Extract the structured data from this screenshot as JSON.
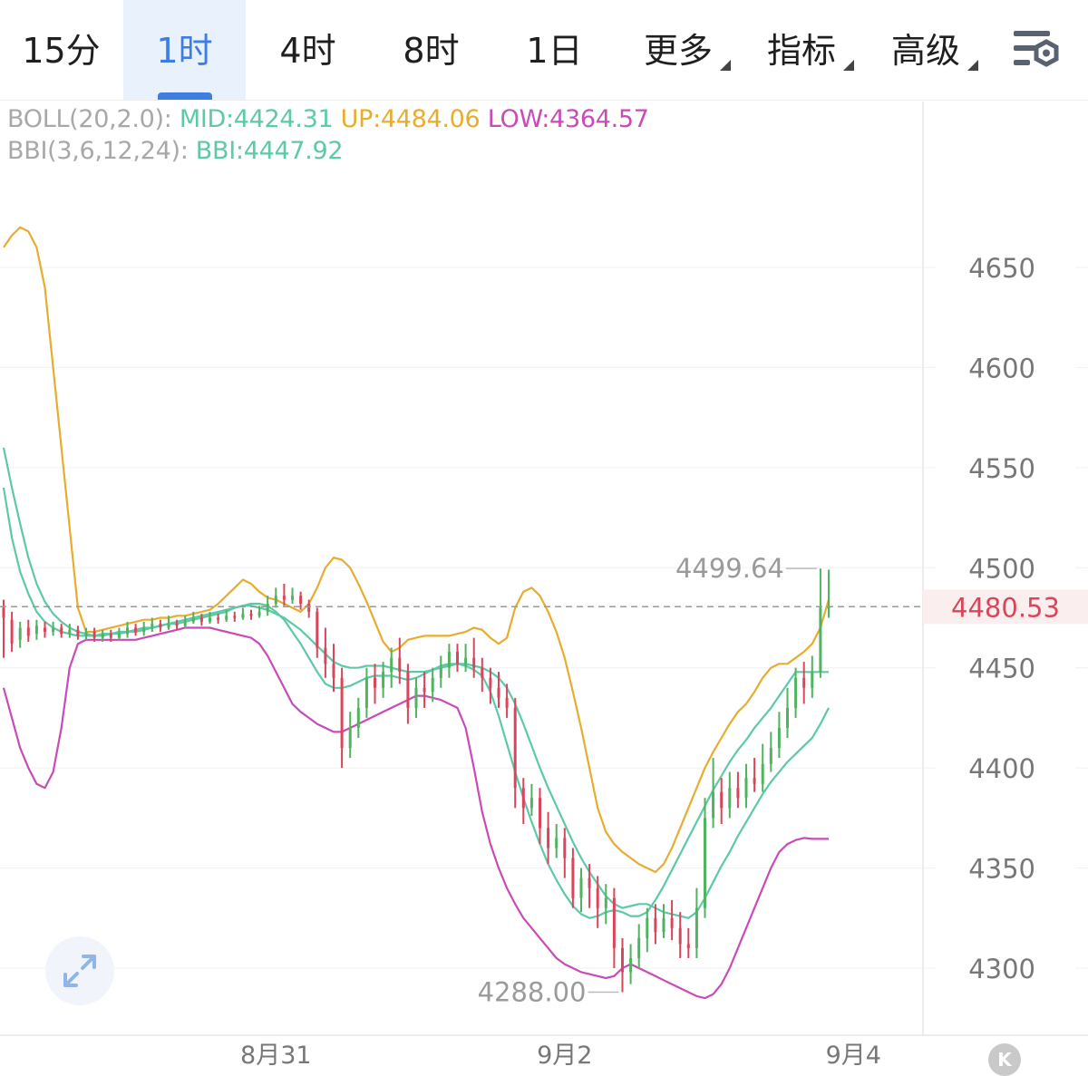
{
  "timeframe_tabs": [
    {
      "label": "15分",
      "active": false
    },
    {
      "label": "1时",
      "active": true
    },
    {
      "label": "4时",
      "active": false
    },
    {
      "label": "8时",
      "active": false
    },
    {
      "label": "1日",
      "active": false
    }
  ],
  "dropdowns": [
    {
      "label": "更多"
    },
    {
      "label": "指标"
    },
    {
      "label": "高级"
    }
  ],
  "icons": {
    "settings": "chart-settings-icon",
    "expand": "expand-arrows-icon",
    "kline": "kline-toggle-icon"
  },
  "kline_button_label": "K",
  "indicators": {
    "boll": {
      "name": "BOLL(20,2.0):",
      "mid": "MID:4424.31",
      "up": "UP:4484.06",
      "low": "LOW:4364.57"
    },
    "bbi": {
      "name": "BBI(3,6,12,24):",
      "bbi": "BBI:4447.92"
    }
  },
  "colors": {
    "accent": "#3d7ee0",
    "mid": "#5cc9a7",
    "up": "#e6ad2e",
    "low": "#c94bb8",
    "bbi": "#5cc9a7",
    "candle_up": "#4fb35f",
    "candle_down": "#d9465b",
    "current_price": "#d9465b"
  },
  "chart_data": {
    "type": "candlestick",
    "ylim": [
      4275,
      4700
    ],
    "y_ticks": [
      "4650",
      "4600",
      "4550",
      "4500",
      "4450",
      "4400",
      "4350",
      "4300"
    ],
    "x_ticks": [
      "8月31",
      "9月2",
      "9月4"
    ],
    "current_price": {
      "label": "4480.53",
      "value": 4480.53
    },
    "annotations": [
      {
        "label": "4499.64",
        "value": 4499.64,
        "bar": 99
      },
      {
        "label": "4288.00",
        "value": 4288.0,
        "bar": 75
      }
    ],
    "x_tick_bars": [
      33,
      68,
      103
    ],
    "candles": [
      [
        4480,
        4475,
        4484,
        4455
      ],
      [
        4474,
        4462,
        4478,
        4458
      ],
      [
        4464,
        4470,
        4473,
        4460
      ],
      [
        4470,
        4466,
        4474,
        4463
      ],
      [
        4467,
        4471,
        4474,
        4464
      ],
      [
        4470,
        4468,
        4473,
        4465
      ],
      [
        4468,
        4470,
        4473,
        4466
      ],
      [
        4470,
        4467,
        4472,
        4465
      ],
      [
        4467,
        4469,
        4472,
        4465
      ],
      [
        4469,
        4466,
        4471,
        4464
      ],
      [
        4466,
        4468,
        4470,
        4464
      ],
      [
        4468,
        4465,
        4470,
        4463
      ],
      [
        4465,
        4467,
        4469,
        4463
      ],
      [
        4467,
        4465,
        4469,
        4463
      ],
      [
        4465,
        4467,
        4470,
        4464
      ],
      [
        4467,
        4470,
        4473,
        4465
      ],
      [
        4470,
        4468,
        4472,
        4466
      ],
      [
        4468,
        4470,
        4473,
        4466
      ],
      [
        4470,
        4472,
        4475,
        4468
      ],
      [
        4472,
        4470,
        4474,
        4468
      ],
      [
        4470,
        4472,
        4476,
        4469
      ],
      [
        4472,
        4471,
        4474,
        4469
      ],
      [
        4471,
        4473,
        4476,
        4470
      ],
      [
        4473,
        4475,
        4478,
        4472
      ],
      [
        4475,
        4473,
        4477,
        4471
      ],
      [
        4473,
        4475,
        4478,
        4472
      ],
      [
        4475,
        4474,
        4477,
        4472
      ],
      [
        4474,
        4476,
        4479,
        4473
      ],
      [
        4476,
        4475,
        4478,
        4473
      ],
      [
        4475,
        4477,
        4480,
        4474
      ],
      [
        4477,
        4476,
        4479,
        4474
      ],
      [
        4476,
        4478,
        4481,
        4475
      ],
      [
        4478,
        4482,
        4486,
        4476
      ],
      [
        4482,
        4486,
        4490,
        4480
      ],
      [
        4486,
        4484,
        4492,
        4481
      ],
      [
        4484,
        4486,
        4490,
        4482
      ],
      [
        4486,
        4482,
        4488,
        4479
      ],
      [
        4482,
        4478,
        4484,
        4475
      ],
      [
        4478,
        4460,
        4480,
        4455
      ],
      [
        4460,
        4452,
        4470,
        4445
      ],
      [
        4452,
        4445,
        4462,
        4438
      ],
      [
        4445,
        4410,
        4450,
        4400
      ],
      [
        4410,
        4420,
        4428,
        4405
      ],
      [
        4420,
        4430,
        4435,
        4415
      ],
      [
        4430,
        4445,
        4450,
        4425
      ],
      [
        4445,
        4440,
        4452,
        4432
      ],
      [
        4440,
        4448,
        4453,
        4435
      ],
      [
        4448,
        4455,
        4460,
        4440
      ],
      [
        4455,
        4448,
        4465,
        4442
      ],
      [
        4448,
        4430,
        4452,
        4422
      ],
      [
        4430,
        4440,
        4445,
        4425
      ],
      [
        4440,
        4438,
        4448,
        4430
      ],
      [
        4438,
        4445,
        4450,
        4433
      ],
      [
        4445,
        4450,
        4456,
        4440
      ],
      [
        4450,
        4458,
        4462,
        4445
      ],
      [
        4458,
        4452,
        4462,
        4448
      ],
      [
        4452,
        4455,
        4462,
        4448
      ],
      [
        4455,
        4450,
        4465,
        4445
      ],
      [
        4450,
        4445,
        4455,
        4438
      ],
      [
        4445,
        4440,
        4450,
        4432
      ],
      [
        4440,
        4435,
        4448,
        4430
      ],
      [
        4435,
        4430,
        4442,
        4425
      ],
      [
        4430,
        4390,
        4435,
        4380
      ],
      [
        4390,
        4380,
        4395,
        4372
      ],
      [
        4380,
        4385,
        4392,
        4376
      ],
      [
        4385,
        4370,
        4390,
        4362
      ],
      [
        4370,
        4360,
        4378,
        4352
      ],
      [
        4360,
        4365,
        4372,
        4355
      ],
      [
        4365,
        4355,
        4370,
        4345
      ],
      [
        4355,
        4335,
        4360,
        4330
      ],
      [
        4335,
        4345,
        4350,
        4328
      ],
      [
        4345,
        4340,
        4352,
        4330
      ],
      [
        4340,
        4330,
        4346,
        4320
      ],
      [
        4330,
        4335,
        4342,
        4322
      ],
      [
        4335,
        4310,
        4340,
        4300
      ],
      [
        4310,
        4298,
        4315,
        4288
      ],
      [
        4298,
        4305,
        4312,
        4292
      ],
      [
        4305,
        4315,
        4322,
        4300
      ],
      [
        4315,
        4325,
        4330,
        4308
      ],
      [
        4325,
        4318,
        4332,
        4312
      ],
      [
        4318,
        4325,
        4332,
        4315
      ],
      [
        4325,
        4320,
        4334,
        4314
      ],
      [
        4320,
        4312,
        4328,
        4305
      ],
      [
        4312,
        4310,
        4320,
        4305
      ],
      [
        4310,
        4330,
        4340,
        4305
      ],
      [
        4330,
        4375,
        4385,
        4325
      ],
      [
        4375,
        4388,
        4405,
        4370
      ],
      [
        4388,
        4380,
        4395,
        4372
      ],
      [
        4380,
        4390,
        4398,
        4375
      ],
      [
        4390,
        4385,
        4398,
        4380
      ],
      [
        4385,
        4395,
        4402,
        4380
      ],
      [
        4395,
        4392,
        4405,
        4388
      ],
      [
        4392,
        4402,
        4412,
        4388
      ],
      [
        4402,
        4410,
        4418,
        4398
      ],
      [
        4410,
        4420,
        4428,
        4405
      ],
      [
        4420,
        4430,
        4440,
        4415
      ],
      [
        4430,
        4445,
        4450,
        4425
      ],
      [
        4445,
        4440,
        4453,
        4432
      ],
      [
        4440,
        4448,
        4456,
        4435
      ],
      [
        4448,
        4480,
        4499.64,
        4445
      ],
      [
        4480,
        4480.53,
        4499,
        4475
      ]
    ],
    "series": [
      {
        "name": "MID",
        "key": "mid",
        "values": [
          4560,
          4540,
          4522,
          4505,
          4492,
          4483,
          4477,
          4473,
          4470,
          4468,
          4467,
          4466,
          4466,
          4467,
          4467,
          4468,
          4468,
          4469,
          4470,
          4471,
          4472,
          4473,
          4474,
          4475,
          4476,
          4477,
          4478,
          4479,
          4480,
          4481,
          4481,
          4480,
          4479,
          4477,
          4475,
          4472,
          4469,
          4465,
          4461,
          4457,
          4453,
          4451,
          4450,
          4450,
          4451,
          4451,
          4451,
          4450,
          4449,
          4448,
          4448,
          4448,
          4449,
          4450,
          4451,
          4452,
          4452,
          4451,
          4450,
          4448,
          4445,
          4440,
          4432,
          4422,
          4411,
          4400,
          4390,
          4381,
          4372,
          4363,
          4355,
          4348,
          4342,
          4336,
          4332,
          4330,
          4331,
          4332,
          4332,
          4330,
          4328,
          4327,
          4326,
          4325,
          4328,
          4335,
          4343,
          4351,
          4358,
          4366,
          4373,
          4380,
          4387,
          4393,
          4398,
          4403,
          4407,
          4411,
          4415,
          4422,
          4430
        ]
      },
      {
        "name": "UP",
        "key": "up",
        "values": [
          4660,
          4666,
          4670,
          4668,
          4660,
          4640,
          4600,
          4560,
          4520,
          4480,
          4468,
          4468,
          4469,
          4470,
          4471,
          4472,
          4473,
          4474,
          4474,
          4475,
          4475,
          4476,
          4476,
          4477,
          4478,
          4479,
          4482,
          4486,
          4490,
          4494,
          4492,
          4488,
          4485,
          4484,
          4482,
          4480,
          4478,
          4482,
          4490,
          4500,
          4505,
          4504,
          4500,
          4492,
          4483,
          4473,
          4463,
          4458,
          4460,
          4464,
          4465,
          4466,
          4466,
          4466,
          4466,
          4467,
          4468,
          4470,
          4469,
          4465,
          4462,
          4465,
          4480,
          4488,
          4490,
          4486,
          4478,
          4468,
          4455,
          4438,
          4420,
          4400,
          4380,
          4368,
          4362,
          4358,
          4355,
          4352,
          4350,
          4348,
          4352,
          4360,
          4370,
          4380,
          4390,
          4400,
          4408,
          4415,
          4422,
          4428,
          4432,
          4438,
          4445,
          4450,
          4452,
          4452,
          4455,
          4458,
          4462,
          4470,
          4484.06
        ]
      },
      {
        "name": "LOW",
        "key": "low",
        "values": [
          4440,
          4425,
          4410,
          4400,
          4392,
          4390,
          4398,
          4420,
          4450,
          4462,
          4464,
          4464,
          4464,
          4464,
          4464,
          4464,
          4464,
          4465,
          4466,
          4467,
          4468,
          4469,
          4470,
          4470,
          4470,
          4470,
          4469,
          4468,
          4467,
          4466,
          4465,
          4462,
          4456,
          4448,
          4440,
          4432,
          4428,
          4425,
          4422,
          4420,
          4418,
          4418,
          4420,
          4422,
          4424,
          4426,
          4428,
          4430,
          4432,
          4434,
          4436,
          4436,
          4435,
          4434,
          4432,
          4430,
          4420,
          4400,
          4378,
          4362,
          4350,
          4340,
          4332,
          4325,
          4320,
          4315,
          4310,
          4305,
          4302,
          4300,
          4298,
          4297,
          4296,
          4295,
          4296,
          4300,
          4302,
          4300,
          4298,
          4296,
          4294,
          4292,
          4290,
          4288,
          4286,
          4285,
          4287,
          4292,
          4300,
          4310,
          4320,
          4330,
          4340,
          4350,
          4358,
          4362,
          4364,
          4365,
          4364.57,
          4364.57,
          4364.57
        ]
      },
      {
        "name": "BBI",
        "key": "bbi",
        "values": [
          4540,
          4515,
          4498,
          4487,
          4478,
          4473,
          4470,
          4468,
          4467,
          4466,
          4466,
          4466,
          4467,
          4467,
          4468,
          4468,
          4469,
          4470,
          4470,
          4471,
          4472,
          4472,
          4473,
          4474,
          4475,
          4476,
          4477,
          4478,
          4480,
          4481,
          4482,
          4482,
          4481,
          4478,
          4474,
          4468,
          4462,
          4455,
          4448,
          4442,
          4440,
          4440,
          4441,
          4443,
          4445,
          4446,
          4446,
          4446,
          4445,
          4444,
          4445,
          4447,
          4449,
          4451,
          4452,
          4452,
          4451,
          4449,
          4446,
          4438,
          4426,
          4412,
          4398,
          4385,
          4373,
          4362,
          4352,
          4344,
          4337,
          4331,
          4327,
          4325,
          4326,
          4328,
          4329,
          4328,
          4326,
          4326,
          4328,
          4334,
          4341,
          4349,
          4357,
          4365,
          4373,
          4381,
          4389,
          4396,
          4403,
          4409,
          4414,
          4420,
          4425,
          4430,
          4436,
          4442,
          4447.92,
          4447.92,
          4447.92,
          4447.92,
          4447.92
        ]
      }
    ]
  }
}
